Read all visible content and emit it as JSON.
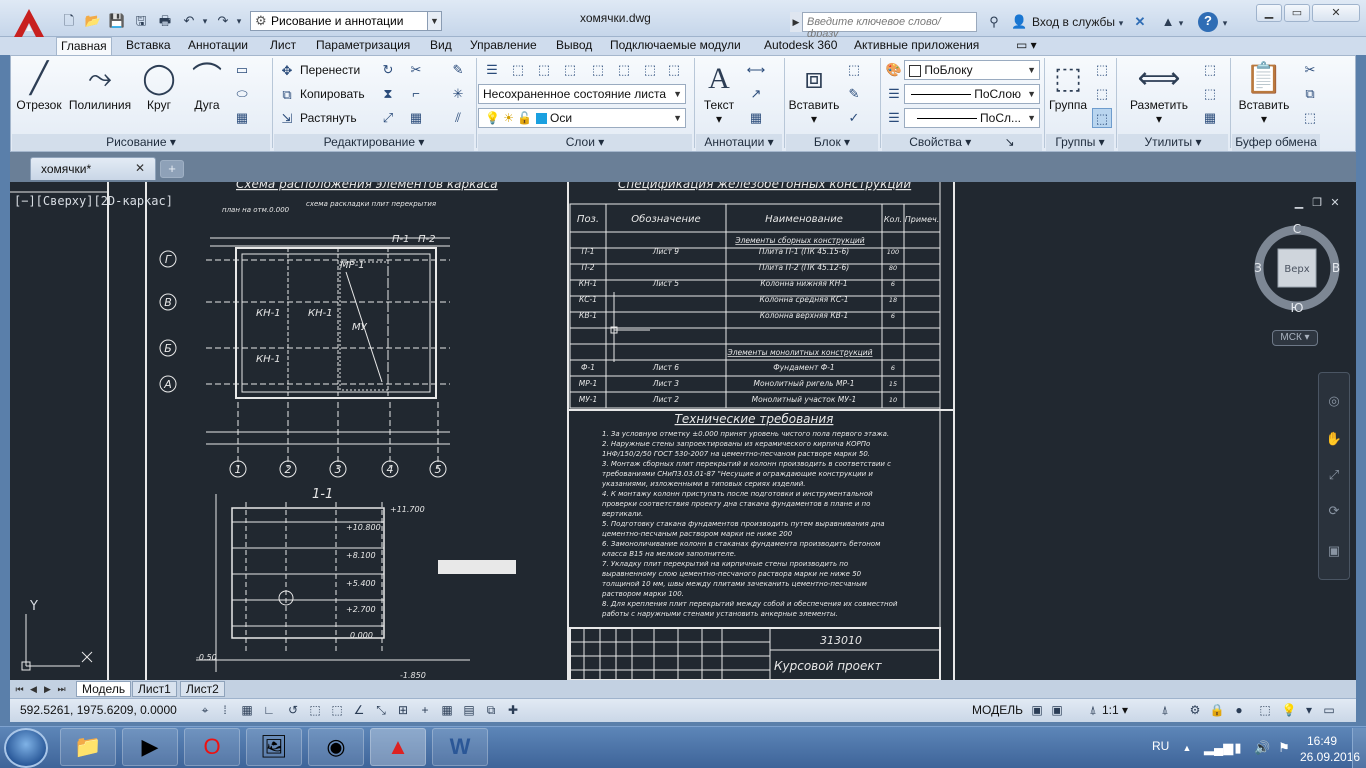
{
  "window": {
    "doc_title": "хомячки.dwg",
    "workspace": "Рисование и аннотации",
    "search_placeholder": "Введите ключевое слово/фразу",
    "login": "Вход в службы"
  },
  "ribbon_tabs": [
    "Главная",
    "Вставка",
    "Аннотации",
    "Лист",
    "Параметризация",
    "Вид",
    "Управление",
    "Вывод",
    "Подключаемые модули",
    "Autodesk 360",
    "Активные приложения"
  ],
  "draw_panel": {
    "line": "Отрезок",
    "polyline": "Полилиния",
    "circle": "Круг",
    "arc": "Дуга",
    "label": "Рисование"
  },
  "modify_panel": {
    "move": "Перенести",
    "copy": "Копировать",
    "stretch": "Растянуть",
    "label": "Редактирование"
  },
  "layers_panel": {
    "state": "Несохраненное состояние листа",
    "layer": "Оси",
    "label": "Слои"
  },
  "annot_panel": {
    "text": "Текст",
    "label": "Аннотации"
  },
  "block_panel": {
    "insert": "Вставить",
    "label": "Блок"
  },
  "props_panel": {
    "color": "ПоБлоку",
    "linetype": "ПоСлою",
    "lineweight": "ПоСл...",
    "label": "Свойства"
  },
  "groups_panel": {
    "group": "Группа",
    "label": "Группы"
  },
  "utils_panel": {
    "measure": "Разметить",
    "label": "Утилиты"
  },
  "clipboard_panel": {
    "paste": "Вставить",
    "label": "Буфер обмена"
  },
  "file_tab": "хомячки*",
  "viewport": {
    "controls": "[−][Сверху][2D-каркас]",
    "cube_top": "Верх",
    "cube_n": "С",
    "cube_s": "Ю",
    "cube_w": "З",
    "cube_e": "В",
    "ucs": "МСК",
    "axis_y": "Y"
  },
  "layout_tabs": [
    "Модель",
    "Лист1",
    "Лист2"
  ],
  "status": {
    "coords": "592.5261, 1975.6209, 0.0000",
    "model": "МОДЕЛЬ",
    "scale": "1:1"
  },
  "drawing": {
    "plan_title": "Схема расположения элементов каркаса",
    "plan_sub1": "план на отм.0.000",
    "plan_sub2": "схема раскладки плит перекрытия",
    "axes_row": [
      "Г",
      "В",
      "Б",
      "А"
    ],
    "axes_col": [
      "1",
      "2",
      "3",
      "4",
      "5"
    ],
    "plan_labels": [
      "КН-1",
      "КН-1",
      "КН-1",
      "МУ",
      "МР-1",
      "П-1",
      "П-2"
    ],
    "section_title": "1-1",
    "spec_title": "Спецификация железобетонных конструкций",
    "spec_headers": [
      "Поз.",
      "Обозначение",
      "Наименование",
      "Кол.",
      "Примеч."
    ],
    "spec_group1": "Элементы сборных конструкций",
    "spec_group2": "Элементы монолитных конструкций",
    "spec_rows": [
      {
        "pos": "П-1",
        "sheet": "Лист 9",
        "name": "Плита П-1 (ПК 45.15-6)",
        "qty": "100"
      },
      {
        "pos": "П-2",
        "sheet": "",
        "name": "Плита П-2 (ПК 45.12-6)",
        "qty": "80"
      },
      {
        "pos": "КН-1",
        "sheet": "Лист 5",
        "name": "Колонна нижняя КН-1",
        "qty": "6"
      },
      {
        "pos": "КС-1",
        "sheet": "",
        "name": "Колонна средняя КС-1",
        "qty": "18"
      },
      {
        "pos": "КВ-1",
        "sheet": "",
        "name": "Колонна верхняя КВ-1",
        "qty": "6"
      },
      {
        "pos": "Ф-1",
        "sheet": "Лист 6",
        "name": "Фундамент Ф-1",
        "qty": "6"
      },
      {
        "pos": "МР-1",
        "sheet": "Лист 3",
        "name": "Монолитный ригель МР-1",
        "qty": "15"
      },
      {
        "pos": "МУ-1",
        "sheet": "Лист 2",
        "name": "Монолитный участок МУ-1",
        "qty": "10"
      }
    ],
    "tech_title": "Технические требования",
    "tech_lines": [
      "1. За условную отметку ±0.000 принят уровень чистого пола первого этажа.",
      "2. Наружные стены запроектированы из керамического кирпича КОРПо",
      "1НФ/150/2/50 ГОСТ 530-2007 на цементно-песчаном растворе марки 50.",
      "3. Монтаж сборных плит перекрытий и колонн производить в соответствии с",
      "требованиями СНиП3.03.01-87 \"Несущие и ограждающие конструкции и",
      "указаниями, изложенными в типовых сериях изделий.",
      "4. К монтажу колонн приступать после подготовки и инструментальной",
      "проверки соответствия проекту дна стакана фундаментов в плане и по",
      "вертикали.",
      "5. Подготовку стакана фундаментов производить путем выравнивания дна",
      "цементно-песчаным раствором марки не ниже 200",
      "6. Замоноличивание колонн в стаканах фундамента производить бетоном",
      "класса В15 на мелком заполнителе.",
      "7. Укладку плит перекрытий на кирпичные стены производить по",
      "выравненному слою цементно-песчаного раствора марки не ниже 50",
      "толщиной 10 мм, швы между плитами зачеканить цементно-песчаным",
      "раствором марки 100.",
      "8. Для крепления плит перекрытий между собой и обеспечения их совместной",
      "работы с наружными стенами установить анкерные элементы."
    ],
    "stamp_code": "313010",
    "stamp_title": "Курсовой проект",
    "sec_levels": [
      "+11.700",
      "+10.800",
      "+8.100",
      "+5.400",
      "+2.700",
      "0.000",
      "-0.50",
      "-1.850"
    ]
  },
  "taskbar": {
    "lang": "RU",
    "time": "16:49",
    "date": "26.09.2016"
  }
}
